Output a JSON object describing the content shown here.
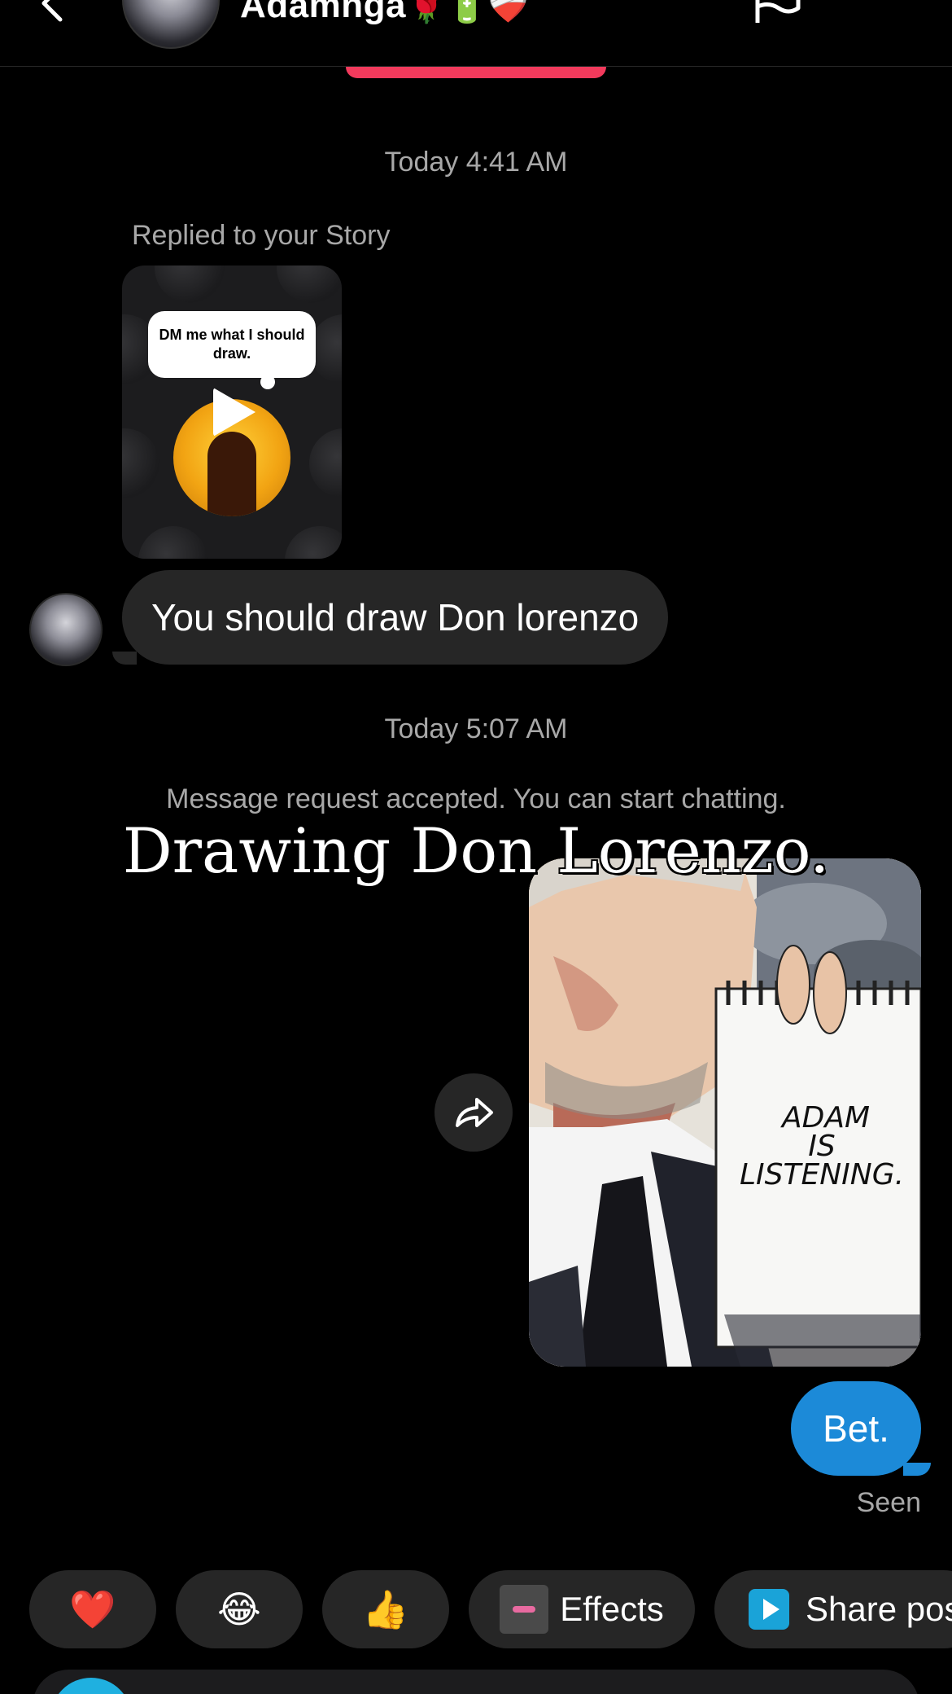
{
  "header": {
    "contact_name": "Adamnga",
    "name_emojis": "🌹🔋❤️‍🩹"
  },
  "chat": {
    "timestamp_1": "Today 4:41 AM",
    "replied_label": "Replied to your Story",
    "story": {
      "bubble_text": "DM me what I should draw."
    },
    "received_message": "You should draw Don lorenzo",
    "timestamp_2": "Today 5:07 AM",
    "system_message": "Message request accepted. You can start chatting.",
    "shared_post": {
      "caption": "Drawing Don Lorenzo.",
      "sign_text_line1": "ADAM",
      "sign_text_line2": "IS",
      "sign_text_line3": "LISTENING."
    },
    "sent_message": "Bet.",
    "seen_label": "Seen"
  },
  "quick_actions": {
    "reaction_1": "❤️",
    "reaction_2": "😂",
    "reaction_3": "👍",
    "effects_label": "Effects",
    "share_label": "Share pos"
  },
  "colors": {
    "background": "#000000",
    "received_bubble": "#262626",
    "sent_bubble": "#1c8ad8",
    "accent_bar": "#f23a5c",
    "secondary_text": "#a8a8a8"
  },
  "icons": {
    "back": "back-chevron-icon",
    "flag": "flag-icon",
    "more": "more-icon",
    "share": "share-arrow-icon",
    "play": "play-icon"
  }
}
